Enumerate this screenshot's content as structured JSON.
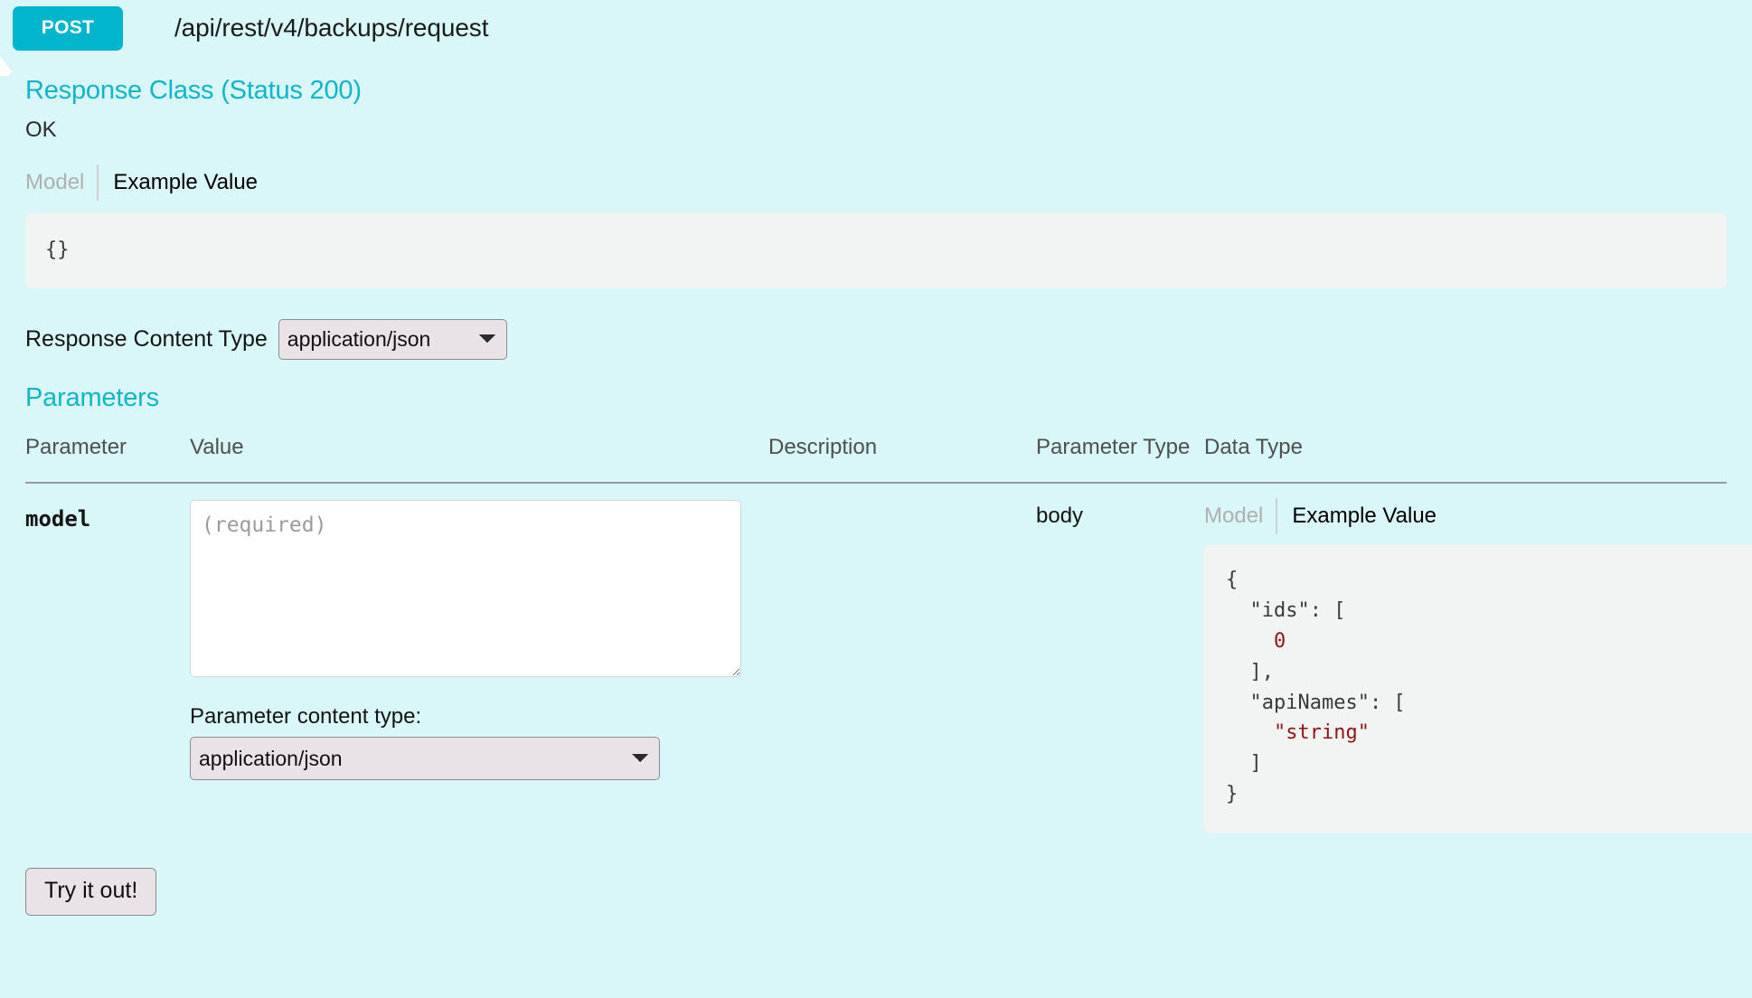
{
  "endpoint": {
    "method": "POST",
    "path": "/api/rest/v4/backups/request",
    "method_color": "#00b5cc"
  },
  "status_icon": {
    "name": "error-exclamation-icon",
    "color": "#e8564f",
    "glyph": "!"
  },
  "response_class": {
    "title": "Response Class (Status 200)",
    "description": "OK",
    "tabs": {
      "model_label": "Model",
      "example_value_label": "Example Value",
      "active": "Example Value"
    },
    "example_value": "{}",
    "content_type": {
      "label": "Response Content Type",
      "selected": "application/json",
      "options": [
        "application/json"
      ]
    }
  },
  "parameters": {
    "title": "Parameters",
    "columns": [
      "Parameter",
      "Value",
      "Description",
      "Parameter Type",
      "Data Type"
    ],
    "rows": [
      {
        "name": "model",
        "value": "",
        "value_placeholder": "(required)",
        "description": "",
        "parameter_type": "body",
        "content_type_label": "Parameter content type:",
        "content_type_selected": "application/json",
        "content_type_options": [
          "application/json"
        ],
        "data_type": {
          "model_label": "Model",
          "example_value_label": "Example Value",
          "active": "Example Value",
          "example_line_1": "{",
          "example_line_2": "  \"ids\": [",
          "example_line_3": "    0",
          "example_line_4": "  ],",
          "example_line_5": "  \"apiNames\": [",
          "example_line_6": "    \"string\"",
          "example_line_7": "  ]",
          "example_line_8": "}"
        }
      }
    ]
  },
  "actions": {
    "try_it_out_label": "Try it out!"
  }
}
